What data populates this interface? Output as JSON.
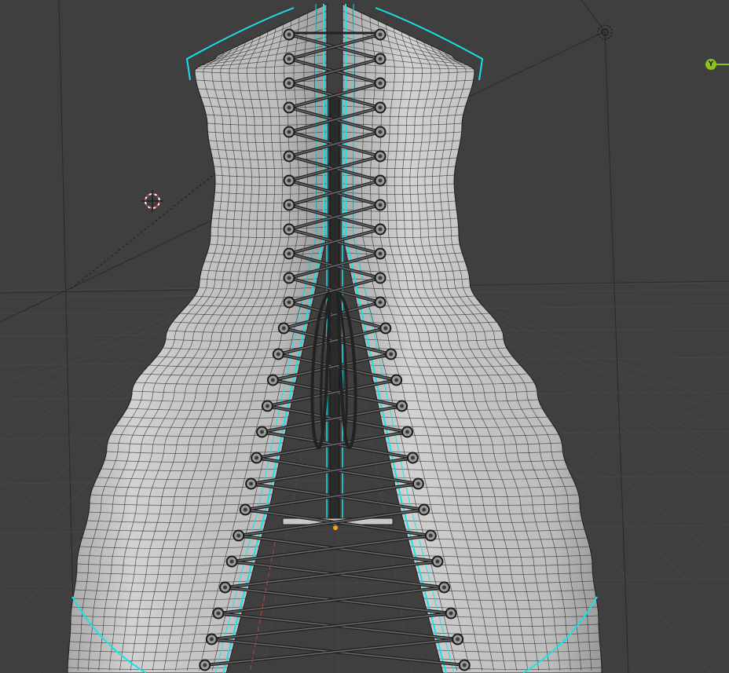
{
  "viewport": {
    "background": "#3f3f3f",
    "grid_color": "#474747",
    "mesh_color": "#c9c9c9",
    "wire_color": "#1e1e1e",
    "selection_outline": "#18e1e8"
  },
  "navigation_gizmo": {
    "y_axis_label": "Y",
    "y_axis_color": "#8cc11f"
  },
  "objects": {
    "dress_mesh": "corset-dress",
    "lacing": "criss-cross-lace",
    "eyelets": "grommet-rings"
  },
  "icons": [
    "3d-cursor-icon",
    "light-object-icon",
    "origin-dot-icon",
    "y-axis-gizmo-icon"
  ]
}
